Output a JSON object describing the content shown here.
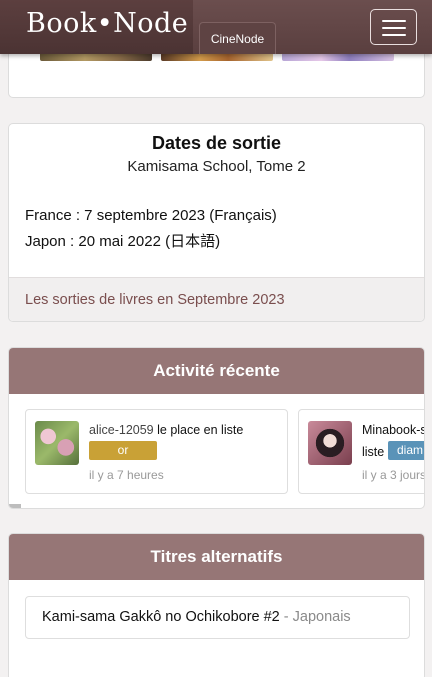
{
  "navbar": {
    "brand": "Book•Node",
    "cinenode_label": "CineNode",
    "menu_icon": "hamburger-icon"
  },
  "release": {
    "title": "Dates de sortie",
    "subtitle": "Kamisama School, Tome 2",
    "france": "France : 7 septembre 2023 (Français)",
    "japon": "Japon : 20 mai 2022 (日本語)",
    "footer_link": "Les sorties de livres en Septembre 2023"
  },
  "activity": {
    "title": "Activité récente",
    "items": [
      {
        "user": "alice-12059",
        "action": " le place en liste",
        "badge": "or",
        "time": "il y a 7 heures"
      },
      {
        "user": "Minabook-s",
        "action_line2": "liste",
        "badge": "diam",
        "time": "il y a 3 jours"
      }
    ]
  },
  "alt_titles": {
    "title": "Titres alternatifs",
    "items": [
      {
        "name": "Kami-sama Gakkô no Ochikobore #2",
        "separator": " - ",
        "language": "Japonais"
      }
    ]
  },
  "colors": {
    "navbar": "#5a3f3f",
    "section_header": "#967676",
    "badge_gold": "#c9a136",
    "badge_blue": "#5a93b8",
    "link": "#7a4e4e"
  }
}
